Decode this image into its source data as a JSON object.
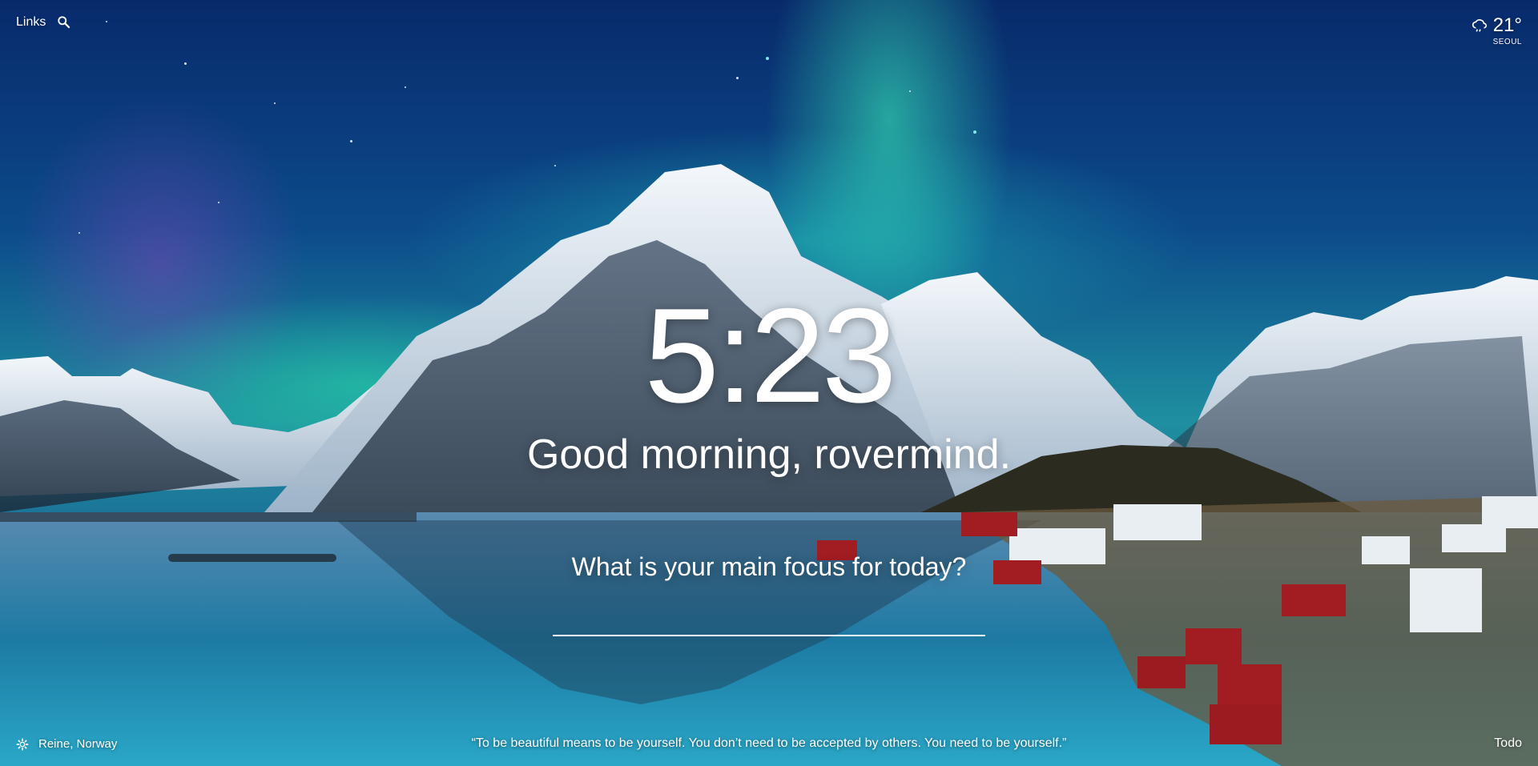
{
  "links": {
    "label": "Links",
    "search_icon": "search-icon"
  },
  "weather": {
    "icon": "cloud-rain-icon",
    "temperature": "21°",
    "city": "SEOUL"
  },
  "clock": {
    "time": "5:23"
  },
  "greeting": {
    "text": "Good morning, rovermind."
  },
  "focus": {
    "prompt": "What is your main focus for today?",
    "value": ""
  },
  "location": {
    "icon": "gear-icon",
    "text": "Reine, Norway"
  },
  "quote": {
    "text": "“To be beautiful means to be yourself. You don’t need to be accepted by others. You need to be yourself.”"
  },
  "todo": {
    "label": "Todo"
  },
  "colors": {
    "text": "#ffffff",
    "sky": "#0b2b5a",
    "aurora": "#3cffbe"
  }
}
